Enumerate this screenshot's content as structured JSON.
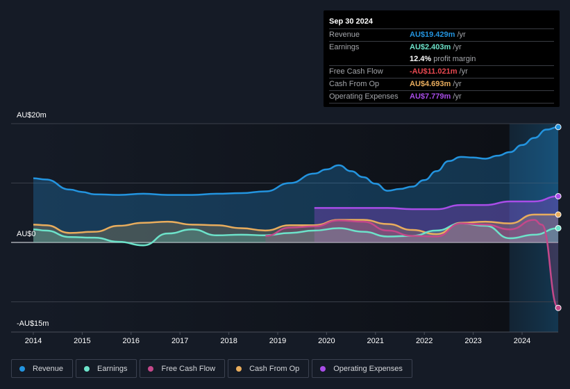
{
  "tooltip": {
    "date": "Sep 30 2024",
    "rows": [
      {
        "label": "Revenue",
        "value": "AU$19.429m",
        "unit": " /yr",
        "color": "#2394df"
      },
      {
        "label": "Earnings",
        "value": "AU$2.403m",
        "unit": " /yr",
        "color": "#6de3ca"
      },
      {
        "label": "",
        "value": "12.4%",
        "unit": " profit margin",
        "color": "#ffffff"
      },
      {
        "label": "Free Cash Flow",
        "value": "-AU$11.021m",
        "unit": " /yr",
        "color": "#e84850"
      },
      {
        "label": "Cash From Op",
        "value": "AU$4.693m",
        "unit": " /yr",
        "color": "#e9ad5d"
      },
      {
        "label": "Operating Expenses",
        "value": "AU$7.779m",
        "unit": " /yr",
        "color": "#a94de8"
      }
    ]
  },
  "legend": [
    {
      "label": "Revenue",
      "color": "#2394df"
    },
    {
      "label": "Earnings",
      "color": "#6de3ca"
    },
    {
      "label": "Free Cash Flow",
      "color": "#c4488a"
    },
    {
      "label": "Cash From Op",
      "color": "#e9ad5d"
    },
    {
      "label": "Operating Expenses",
      "color": "#a94de8"
    }
  ],
  "chart_data": {
    "type": "line",
    "title": "",
    "xlabel": "",
    "ylabel": "",
    "y_tick_labels": [
      "AU$20m",
      "AU$0",
      "-AU$15m"
    ],
    "x_tick_labels": [
      "2014",
      "2015",
      "2016",
      "2017",
      "2018",
      "2019",
      "2020",
      "2021",
      "2022",
      "2023",
      "2024"
    ],
    "xlim": [
      2013.55,
      2024.85
    ],
    "ylim": [
      -15,
      20
    ],
    "gridlines": [
      20,
      10,
      0,
      -10
    ],
    "highlight_from": 2023.74,
    "legend_position": "bottom",
    "series": [
      {
        "name": "Revenue",
        "color": "#2394df",
        "x": [
          2014.0,
          2014.25,
          2014.75,
          2015.0,
          2015.25,
          2015.75,
          2016.25,
          2016.75,
          2017.25,
          2017.75,
          2018.25,
          2018.75,
          2019.25,
          2019.75,
          2020.0,
          2020.25,
          2020.5,
          2020.75,
          2021.0,
          2021.25,
          2021.5,
          2021.75,
          2022.0,
          2022.25,
          2022.5,
          2022.75,
          2023.0,
          2023.25,
          2023.5,
          2023.75,
          2024.0,
          2024.25,
          2024.5,
          2024.74
        ],
        "values": [
          10.8,
          10.6,
          8.9,
          8.5,
          8.1,
          8.0,
          8.2,
          8.0,
          8.0,
          8.2,
          8.3,
          8.6,
          10.0,
          11.6,
          12.3,
          13.0,
          12.0,
          11.0,
          9.9,
          8.7,
          9.0,
          9.4,
          10.5,
          12.0,
          13.7,
          14.4,
          14.3,
          14.1,
          14.6,
          15.2,
          16.4,
          17.6,
          19.0,
          19.43
        ]
      },
      {
        "name": "Operating Expenses",
        "color": "#a94de8",
        "x": [
          2019.75,
          2020.25,
          2020.75,
          2021.25,
          2021.75,
          2022.25,
          2022.75,
          2023.25,
          2023.75,
          2024.25,
          2024.74
        ],
        "values": [
          5.8,
          5.8,
          5.8,
          5.8,
          5.6,
          5.6,
          6.3,
          6.3,
          6.9,
          6.9,
          7.78
        ]
      },
      {
        "name": "Cash From Op",
        "color": "#e9ad5d",
        "x": [
          2014.0,
          2014.25,
          2014.75,
          2015.25,
          2015.75,
          2016.25,
          2016.75,
          2017.25,
          2017.75,
          2018.25,
          2018.75,
          2019.25,
          2019.75,
          2020.25,
          2020.75,
          2021.25,
          2021.75,
          2022.25,
          2022.75,
          2023.25,
          2023.75,
          2024.25,
          2024.74
        ],
        "values": [
          3.0,
          2.9,
          1.6,
          1.8,
          2.8,
          3.3,
          3.5,
          3.0,
          2.9,
          2.4,
          2.0,
          2.9,
          2.9,
          3.8,
          3.8,
          3.1,
          2.1,
          1.4,
          3.3,
          3.5,
          3.2,
          4.7,
          4.69
        ]
      },
      {
        "name": "Earnings",
        "color": "#6de3ca",
        "x": [
          2014.0,
          2014.25,
          2014.75,
          2015.25,
          2015.75,
          2016.25,
          2016.75,
          2017.25,
          2017.75,
          2018.25,
          2018.75,
          2019.25,
          2019.75,
          2020.25,
          2020.75,
          2021.25,
          2021.75,
          2022.25,
          2022.75,
          2023.25,
          2023.75,
          2024.25,
          2024.74
        ],
        "values": [
          2.2,
          2.0,
          0.9,
          0.8,
          0.1,
          -0.5,
          1.5,
          2.2,
          1.2,
          1.3,
          1.2,
          1.6,
          2.0,
          2.4,
          1.8,
          1.0,
          1.1,
          2.0,
          3.2,
          2.8,
          0.7,
          1.3,
          2.4
        ]
      },
      {
        "name": "Free Cash Flow",
        "color": "#c4488a",
        "x": [
          2018.75,
          2019.25,
          2019.75,
          2020.25,
          2020.75,
          2021.25,
          2021.75,
          2022.25,
          2022.75,
          2023.25,
          2023.75,
          2024.25,
          2024.4,
          2024.74
        ],
        "values": [
          1.1,
          2.5,
          2.7,
          3.7,
          3.5,
          2.0,
          1.1,
          1.0,
          3.2,
          3.0,
          2.2,
          3.8,
          3.0,
          -11.02
        ]
      }
    ]
  }
}
